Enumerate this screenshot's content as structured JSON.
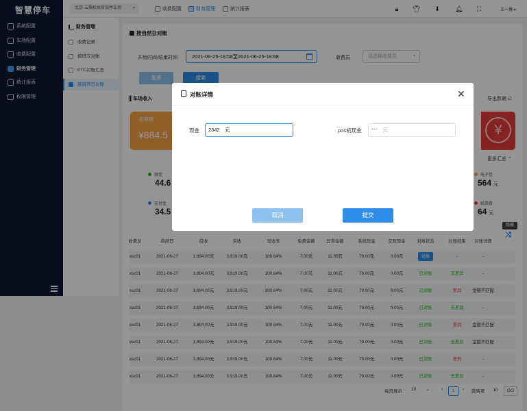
{
  "app": {
    "logo": "智慧停车"
  },
  "sidebar": {
    "items": [
      {
        "label": "系统配置",
        "active": false
      },
      {
        "label": "车场配置",
        "active": false
      },
      {
        "label": "收费配置",
        "active": false
      },
      {
        "label": "财务管理",
        "active": true
      },
      {
        "label": "统计报表",
        "active": false
      },
      {
        "label": "权限管理",
        "active": false
      }
    ]
  },
  "header": {
    "location": "北京-五棵松体育馆停车场",
    "tabs": [
      {
        "label": "收费配置"
      },
      {
        "label": "财务管理"
      },
      {
        "label": "统计报表"
      }
    ],
    "user": "王一博"
  },
  "submenu": {
    "title": "财务管理",
    "items": [
      {
        "label": "收费记录"
      },
      {
        "label": "按班次对账"
      },
      {
        "label": "ETC对账汇总"
      },
      {
        "label": "按自然日对账"
      }
    ]
  },
  "page": {
    "title": "按自然日对账",
    "filter": {
      "date_label": "开始时间/结束时间",
      "date_value": "2021-06-25-18:58至2021-06-25-18:58",
      "collector_label": "收费员",
      "collector_placeholder": "请选择收费员",
      "reset_label": "重置",
      "search_label": "搜索"
    },
    "section_title": "车场收入",
    "export_label": "导出数据",
    "more_label": "更多汇总",
    "receivable": {
      "label": "应收款",
      "value": "¥884.5"
    },
    "stats": [
      {
        "label": "微信",
        "value": "44.6",
        "color": "#2bb31f"
      },
      {
        "label": "支付宝",
        "value": "34.5",
        "color": "#2e8de8"
      },
      {
        "label": "电子卷",
        "value": "564",
        "unit": "元",
        "color": "#f5a045"
      },
      {
        "label": "纸质卷",
        "value": "64",
        "unit": "元",
        "color": "#e23c3c"
      }
    ],
    "float_tag": "隐藏",
    "table": {
      "headers": [
        "收费员",
        "自然日",
        "应收",
        "实收",
        "现收率",
        "免费金额",
        "异常金额",
        "系统现金",
        "交账现金",
        "对账状态",
        "对账结果",
        "对账详情"
      ],
      "rows": [
        [
          "xsc01",
          "2021-06-27",
          "3,894.00元",
          "3,919.00元",
          "100.64%",
          "7.00元",
          "11.00元",
          "79.00元",
          "0.00元",
          "对账",
          "-",
          "-"
        ],
        [
          "xsc01",
          "2021-06-27",
          "3,894.00元",
          "3,919.00元",
          "100.64%",
          "7.00元",
          "11.00元",
          "79.00元",
          "0.00元",
          "已对账",
          "无差异",
          "-"
        ],
        [
          "xsc01",
          "2021-06-27",
          "3,894.00元",
          "3,919.00元",
          "100.64%",
          "7.00元",
          "11.00元",
          "79.00元",
          "0.00元",
          "已对账",
          "差异",
          "金额不匹配"
        ],
        [
          "xsc01",
          "2021-06-27",
          "3,894.00元",
          "3,919.00元",
          "100.64%",
          "7.00元",
          "11.00元",
          "79.00元",
          "0.00元",
          "已对账",
          "无差异",
          "-"
        ],
        [
          "xsc01",
          "2021-06-27",
          "3,894.00元",
          "3,919.00元",
          "100.64%",
          "7.00元",
          "11.00元",
          "79.00元",
          "0.00元",
          "已对账",
          "差异",
          "金额不匹配"
        ],
        [
          "xsc01",
          "2021-06-27",
          "3,894.00元",
          "3,919.00元",
          "100.64%",
          "7.00元",
          "11.00元",
          "79.00元",
          "0.00元",
          "已对账",
          "无差异",
          "金额不匹配"
        ],
        [
          "xsc01",
          "2021-06-27",
          "3,894.00元",
          "3,919.00元",
          "100.64%",
          "7.00元",
          "11.00元",
          "79.00元",
          "0.00元",
          "已对账",
          "差异",
          "-"
        ],
        [
          "xsc01",
          "2021-06-27",
          "3,894.00元",
          "3,919.00元",
          "100.64%",
          "7.00元",
          "11.00元",
          "79.00元",
          "0.00元",
          "已对账",
          "无差异",
          "-"
        ]
      ]
    },
    "pagination": {
      "per_page_label": "每页展示",
      "per_page": "10",
      "current_page": "1",
      "goto_label": "跳转至",
      "goto_value": "10",
      "go_label": "GO"
    }
  },
  "modal": {
    "title": "对账详情",
    "cash_label": "现金",
    "cash_value": "2342　元",
    "pos_label": "pos机现金",
    "pos_value": "***　元",
    "cancel_label": "取消",
    "submit_label": "提交"
  },
  "colors": {
    "primary": "#2e8de8",
    "sidebar_bg": "#0e1733",
    "orange": "#f5a045",
    "red": "#e83c3c",
    "green": "#2bb31f"
  }
}
